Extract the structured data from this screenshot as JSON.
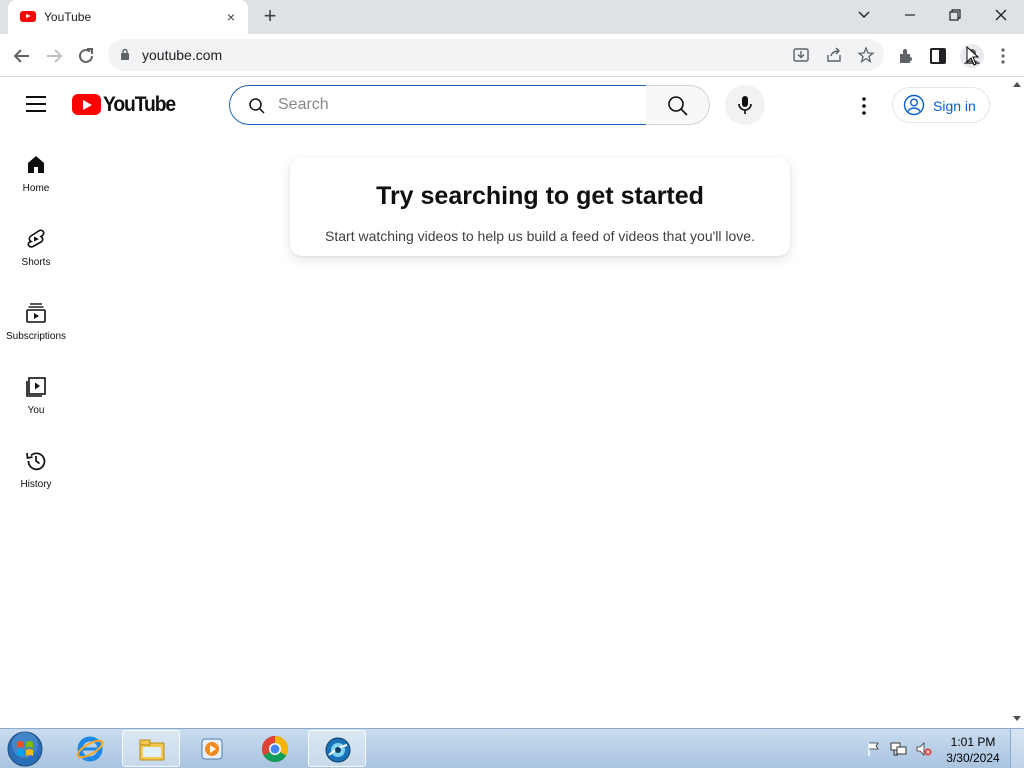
{
  "browser": {
    "tab": {
      "title": "YouTube",
      "close_label": "×"
    },
    "new_tab_label": "+",
    "url": "youtube.com"
  },
  "youtube": {
    "logo_text": "YouTube",
    "search": {
      "placeholder": "Search",
      "value": ""
    },
    "signin_label": "Sign in",
    "guide": [
      {
        "label": "Home",
        "icon": "home-icon"
      },
      {
        "label": "Shorts",
        "icon": "shorts-icon"
      },
      {
        "label": "Subscriptions",
        "icon": "subscriptions-icon"
      },
      {
        "label": "You",
        "icon": "you-icon"
      },
      {
        "label": "History",
        "icon": "history-icon"
      }
    ],
    "empty_state": {
      "title": "Try searching to get started",
      "subtitle": "Start watching videos to help us build a feed of videos that you'll love."
    }
  },
  "taskbar": {
    "time": "1:01 PM",
    "date": "3/30/2024",
    "pinned": [
      "internet-explorer-icon",
      "file-explorer-icon",
      "media-player-icon",
      "chrome-icon",
      "active-app-icon"
    ]
  },
  "colors": {
    "brand_red": "#ff0000",
    "link_blue": "#065fd4",
    "search_focus": "#1c62b9",
    "taskbar": "#b9d1ea"
  }
}
